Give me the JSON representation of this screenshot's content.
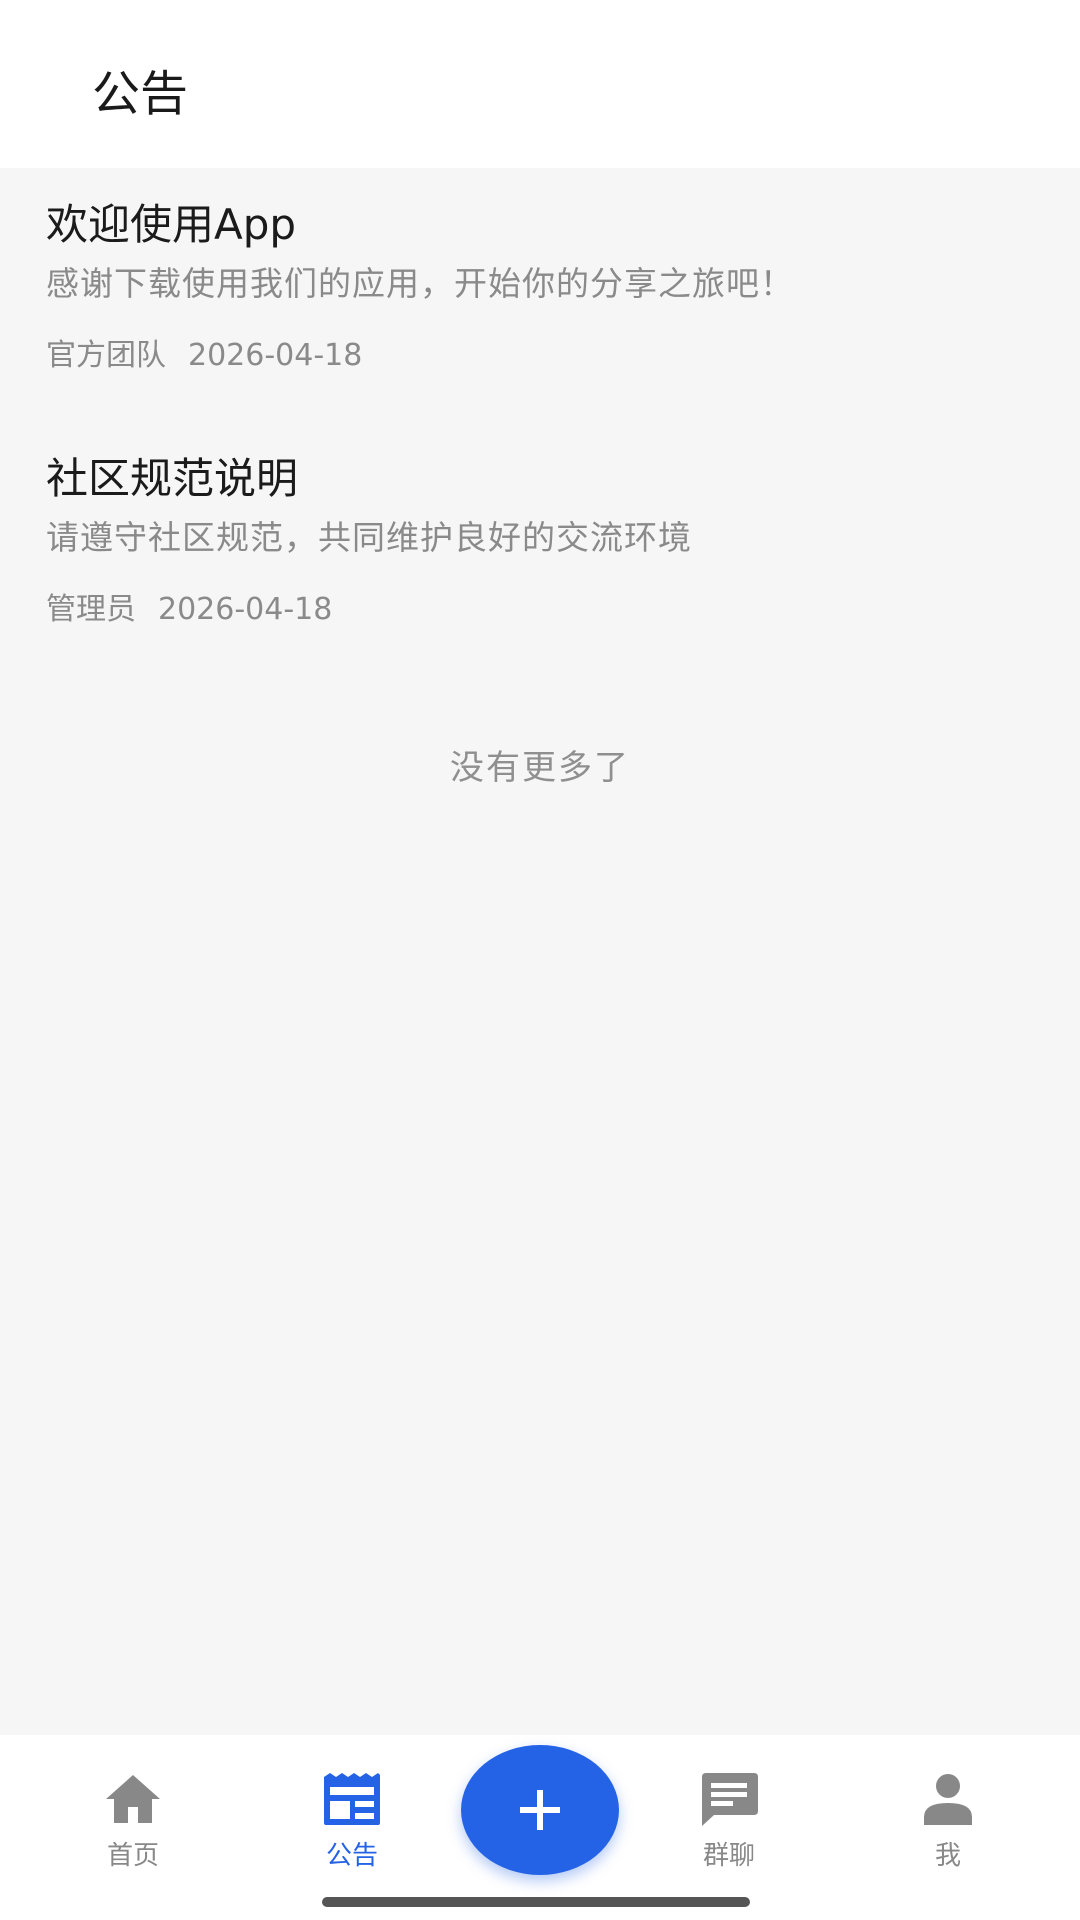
{
  "header": {
    "title": "公告"
  },
  "announcements": [
    {
      "title": "欢迎使用App",
      "description": "感谢下载使用我们的应用，开始你的分享之旅吧！",
      "author": "官方团队",
      "date": "2026-04-18"
    },
    {
      "title": "社区规范说明",
      "description": "请遵守社区规范，共同维护良好的交流环境",
      "author": "管理员",
      "date": "2026-04-18"
    }
  ],
  "list_footer": "没有更多了",
  "bottom_nav": {
    "items": [
      {
        "label": "首页",
        "icon": "home-icon",
        "active": false
      },
      {
        "label": "公告",
        "icon": "announcement-icon",
        "active": true
      },
      {
        "label": "群聊",
        "icon": "chat-icon",
        "active": false
      },
      {
        "label": "我",
        "icon": "person-icon",
        "active": false
      }
    ],
    "fab_icon": "plus-icon"
  },
  "colors": {
    "accent": "#2563e6",
    "inactive": "#888888",
    "background": "#f6f6f6",
    "surface": "#ffffff"
  }
}
